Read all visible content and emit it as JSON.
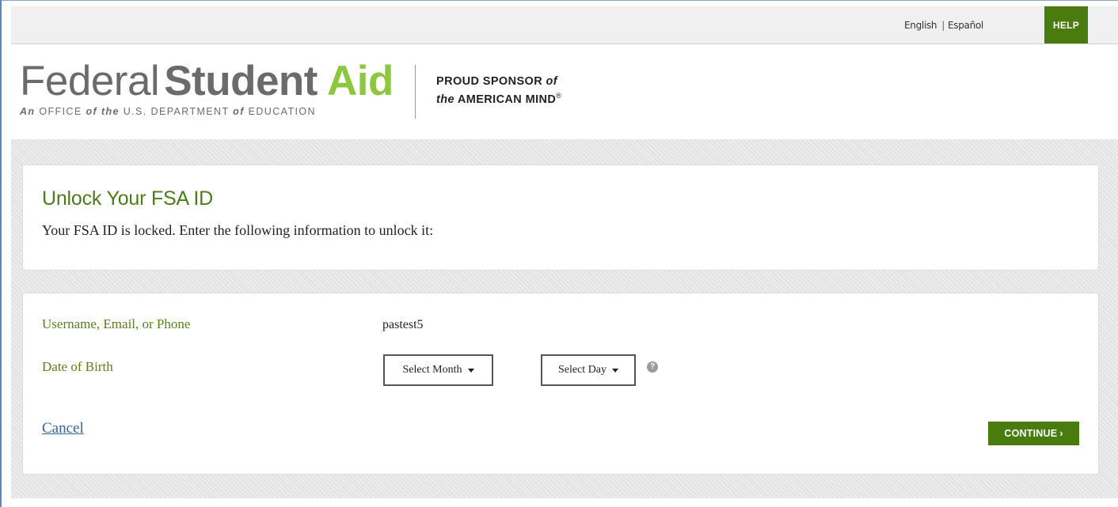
{
  "topbar": {
    "languages": [
      "English",
      "Español"
    ],
    "separator": "|",
    "help_label": "HELP"
  },
  "header": {
    "logo": {
      "word1": "Federal",
      "word2": "Student",
      "word3": "Aid",
      "subtitle_parts": [
        "An",
        "OFFICE",
        "of the",
        "U.S. DEPARTMENT",
        "of",
        "EDUCATION"
      ]
    },
    "sponsor": {
      "line1": "PROUD SPONSOR",
      "line1_italic": "of",
      "line2_italic": "the",
      "line2": "AMERICAN MIND",
      "mark": "®"
    }
  },
  "intro_panel": {
    "title": "Unlock Your FSA ID",
    "text": "Your FSA ID is locked. Enter the following information to unlock it:"
  },
  "form": {
    "username_label": "Username, Email, or Phone",
    "username_value": "pastest5",
    "dob_label": "Date of Birth",
    "month_select": "Select Month",
    "day_select": "Select Day",
    "help_icon_glyph": "?",
    "cancel_label": "Cancel",
    "continue_label": "CONTINUE",
    "continue_chevron": "›"
  },
  "colors": {
    "brand_green": "#4a7b0e",
    "logo_green": "#8dc63f",
    "label_green": "#5a7e1c",
    "link_blue": "#336699"
  },
  "icons": {
    "help": "question-circle-icon",
    "dropdown": "caret-down-icon",
    "continue": "chevron-right-icon"
  }
}
